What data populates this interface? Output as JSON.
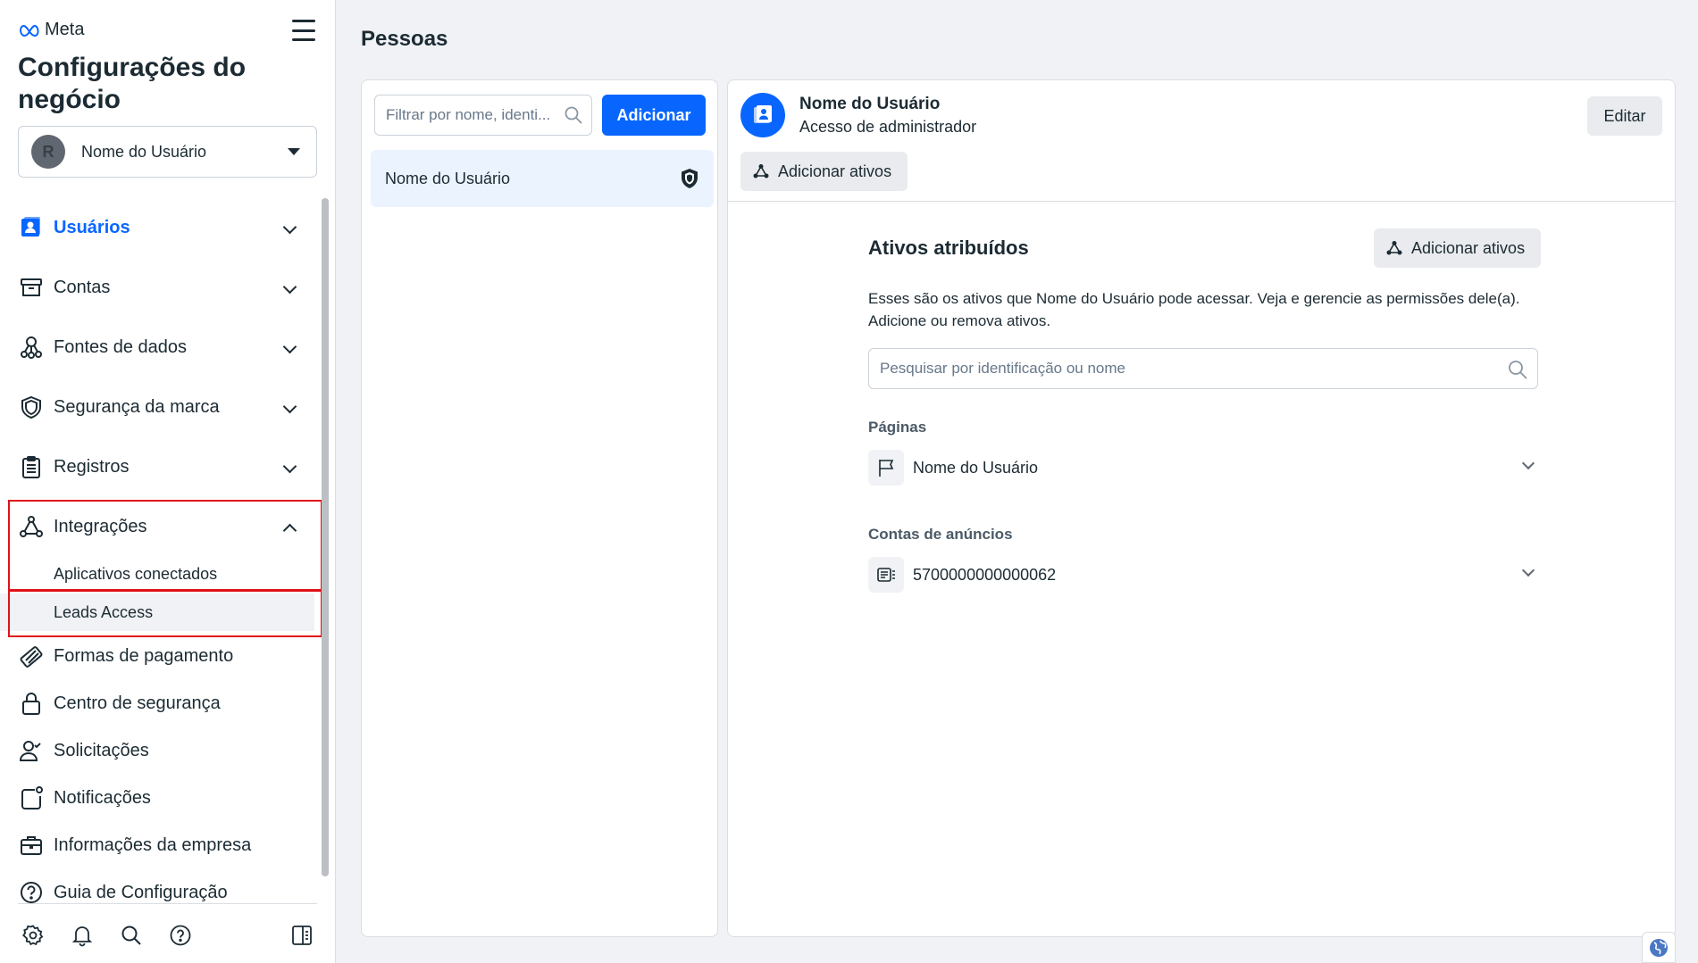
{
  "sidebar": {
    "brand": "Meta",
    "title": "Configurações do negócio",
    "account": {
      "initial": "R",
      "name": "Nome do Usuário"
    },
    "nav": [
      {
        "label": "Usuários",
        "icon": "users-icon",
        "active": true
      },
      {
        "label": "Contas",
        "icon": "archive-icon"
      },
      {
        "label": "Fontes de dados",
        "icon": "data-sources-icon"
      },
      {
        "label": "Segurança da marca",
        "icon": "shield-icon"
      },
      {
        "label": "Registros",
        "icon": "clipboard-icon"
      },
      {
        "label": "Integrações",
        "icon": "integrations-icon",
        "expanded": true
      },
      {
        "label": "Formas de pagamento",
        "icon": "credit-card-icon"
      },
      {
        "label": "Centro de segurança",
        "icon": "lock-icon"
      },
      {
        "label": "Solicitações",
        "icon": "person-check-icon"
      },
      {
        "label": "Notificações",
        "icon": "notification-icon"
      },
      {
        "label": "Informações da empresa",
        "icon": "briefcase-icon"
      },
      {
        "label": "Guia de Configuração",
        "icon": "help-icon"
      }
    ],
    "integrations_sub": [
      {
        "label": "Aplicativos conectados"
      },
      {
        "label": "Leads Access",
        "selected": true
      }
    ],
    "bottom_icons": [
      "settings-icon",
      "bell-icon",
      "search-icon",
      "help-icon",
      "panel-toggle-icon"
    ]
  },
  "main": {
    "page_title": "Pessoas",
    "people": {
      "filter_placeholder": "Filtrar por nome, identi...",
      "add_label": "Adicionar",
      "rows": [
        {
          "name": "Nome do Usuário"
        }
      ]
    },
    "detail": {
      "user_name": "Nome do Usuário",
      "role": "Acesso de administrador",
      "edit_label": "Editar",
      "add_assets_label": "Adicionar ativos",
      "assets_title": "Ativos atribuídos",
      "assets_add_label": "Adicionar ativos",
      "assets_description": "Esses são os ativos que Nome do Usuário pode acessar. Veja e gerencie as permissões dele(a). Adicione ou remova ativos.",
      "assets_search_placeholder": "Pesquisar por identificação ou nome",
      "pages_label": "Páginas",
      "page_item": "Nome do Usuário",
      "ad_accounts_label": "Contas de anúncios",
      "ad_account_item": "5700000000000062"
    }
  },
  "colors": {
    "accent": "#0866ff",
    "highlight": "#e0121a",
    "selected_row": "#ebf3ff"
  }
}
